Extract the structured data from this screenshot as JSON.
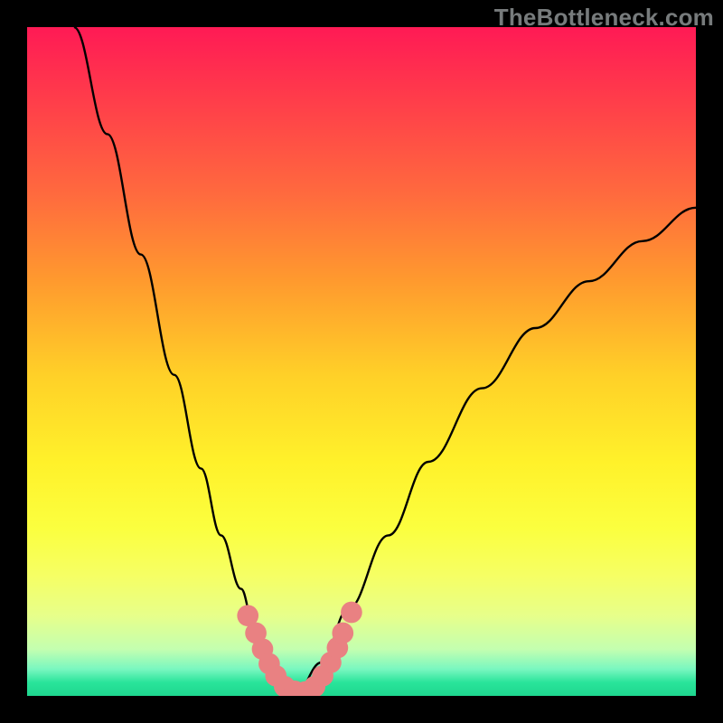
{
  "watermark": "TheBottleneck.com",
  "colors": {
    "background": "#000000",
    "curve_stroke": "#000000",
    "marker_fill": "#e98182",
    "gradient_top": "#ff1a55",
    "gradient_bottom": "#1fd68f"
  },
  "chart_data": {
    "type": "line",
    "title": "",
    "xlabel": "",
    "ylabel": "",
    "xlim": [
      0,
      100
    ],
    "ylim": [
      0,
      100
    ],
    "note": "No axis tick labels are visible; x/y values are a qualitative 0–100 estimate based on position within the plot area.",
    "series": [
      {
        "name": "left-curve",
        "x": [
          7,
          12,
          17,
          22,
          26,
          29,
          32,
          34,
          36,
          38,
          40
        ],
        "y": [
          100,
          84,
          66,
          48,
          34,
          24,
          16,
          10,
          5,
          2,
          0
        ]
      },
      {
        "name": "right-curve",
        "x": [
          40,
          44,
          48,
          54,
          60,
          68,
          76,
          84,
          92,
          100
        ],
        "y": [
          0,
          5,
          13,
          24,
          35,
          46,
          55,
          62,
          68,
          73
        ]
      }
    ],
    "markers": [
      {
        "name": "marker-small-left",
        "x": 33.0,
        "y": 12.0,
        "r": 1.6
      },
      {
        "name": "marker-left-1",
        "x": 34.2,
        "y": 9.4,
        "r": 1.6
      },
      {
        "name": "marker-left-2",
        "x": 35.2,
        "y": 7.0,
        "r": 1.6
      },
      {
        "name": "marker-left-3",
        "x": 36.2,
        "y": 4.8,
        "r": 1.6
      },
      {
        "name": "marker-left-4",
        "x": 37.2,
        "y": 3.0,
        "r": 1.6
      },
      {
        "name": "marker-bottom-1",
        "x": 38.5,
        "y": 1.4,
        "r": 1.6
      },
      {
        "name": "marker-bottom-2",
        "x": 40.0,
        "y": 0.7,
        "r": 1.6
      },
      {
        "name": "marker-bottom-3",
        "x": 41.6,
        "y": 0.6,
        "r": 1.6
      },
      {
        "name": "marker-bottom-4",
        "x": 43.0,
        "y": 1.4,
        "r": 1.6
      },
      {
        "name": "marker-right-1",
        "x": 44.2,
        "y": 3.0,
        "r": 1.6
      },
      {
        "name": "marker-right-2",
        "x": 45.4,
        "y": 5.0,
        "r": 1.6
      },
      {
        "name": "marker-right-3",
        "x": 46.4,
        "y": 7.2,
        "r": 1.6
      },
      {
        "name": "marker-right-4",
        "x": 47.2,
        "y": 9.4,
        "r": 1.6
      },
      {
        "name": "marker-small-right",
        "x": 48.5,
        "y": 12.5,
        "r": 1.6
      }
    ]
  }
}
